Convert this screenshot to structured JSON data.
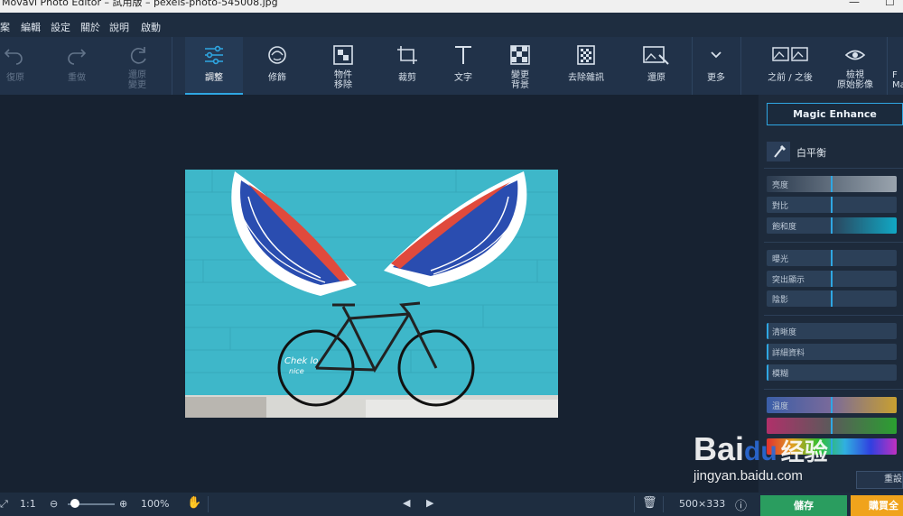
{
  "window": {
    "title": "Movavi Photo Editor – 試用版 – pexels-photo-545008.jpg"
  },
  "menu": [
    "案",
    "編輯",
    "設定",
    "關於",
    "說明",
    "啟動"
  ],
  "toolbar": {
    "undo": "復原",
    "redo": "重做",
    "restore_adjust": [
      "還原",
      "變更"
    ],
    "adjust": "調整",
    "retouch": "修飾",
    "object_removal": [
      "物件",
      "移除"
    ],
    "crop": "裁剪",
    "text": "文字",
    "change_bg": [
      "變更",
      "背景"
    ],
    "denoise": "去除雜訊",
    "restore": "還原",
    "more": "更多",
    "before_after": "之前 / 之後",
    "view_original": [
      "檢視",
      "原始影像"
    ],
    "cut_label": [
      "F",
      "Ma"
    ]
  },
  "panel": {
    "magic_enhance": "Magic Enhance",
    "white_balance": "白平衡",
    "sliders_basic": [
      "亮度",
      "對比",
      "飽和度"
    ],
    "sliders_light": [
      "曝光",
      "突出顯示",
      "陰影"
    ],
    "sliders_detail": [
      "清晰度",
      "詳細資料",
      "模糊"
    ],
    "sliders_color": [
      "溫度",
      "",
      ""
    ],
    "reset": "重設"
  },
  "statusbar": {
    "zoom_ratio": "1:1",
    "zoom_percent": "100%",
    "zoom_level": 0.15,
    "image_size": "500×333",
    "save": "儲存",
    "buy": "購買全"
  },
  "watermark": {
    "brand": "Bai",
    "paw": "du",
    "cn": "经验",
    "url": "jingyan.baidu.com"
  },
  "colors": {
    "accent": "#2fa7e3",
    "save": "#2a9d5f",
    "buy": "#f0a31c",
    "wall": "#3eb7c9"
  }
}
